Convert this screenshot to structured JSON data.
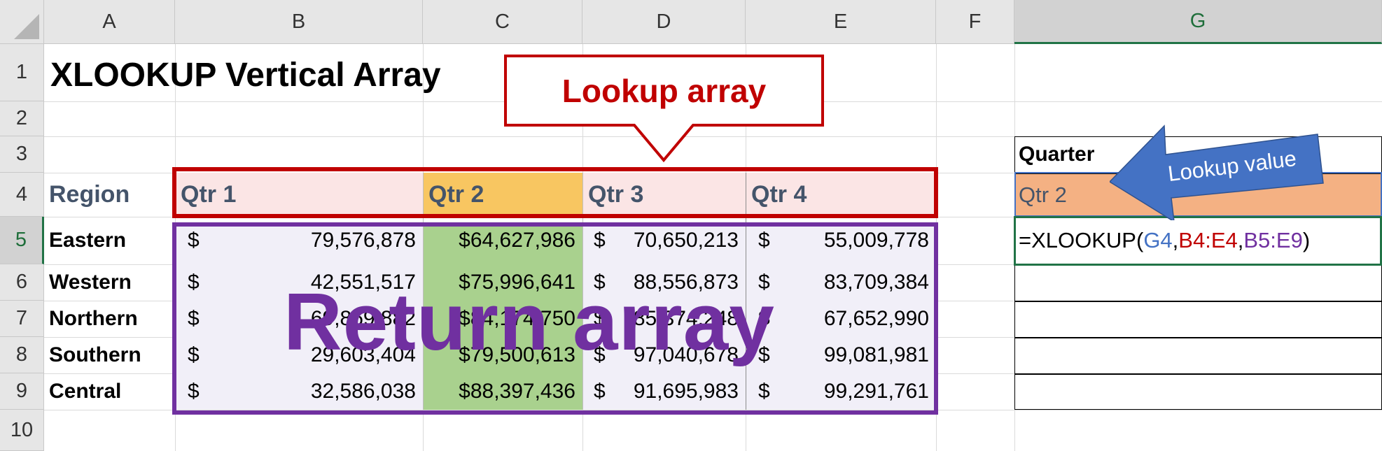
{
  "columns": [
    "A",
    "B",
    "C",
    "D",
    "E",
    "F",
    "G"
  ],
  "rows": [
    "1",
    "2",
    "3",
    "4",
    "5",
    "6",
    "7",
    "8",
    "9",
    "10"
  ],
  "title": "XLOOKUP Vertical Array",
  "header_row": {
    "region": "Region",
    "quarters": [
      "Qtr 1",
      "Qtr 2",
      "Qtr 3",
      "Qtr 4"
    ]
  },
  "table": [
    {
      "region": "Eastern",
      "q1": "79,576,878",
      "q2": "$64,627,986",
      "q3": "70,650,213",
      "q4": "55,009,778"
    },
    {
      "region": "Western",
      "q1": "42,551,517",
      "q2": "$75,996,641",
      "q3": "88,556,873",
      "q4": "83,709,384"
    },
    {
      "region": "Northern",
      "q1": "69,869,882",
      "q2": "$84,174,750",
      "q3": "85,374,248",
      "q4": "67,652,990"
    },
    {
      "region": "Southern",
      "q1": "29,603,404",
      "q2": "$79,500,613",
      "q3": "97,040,678",
      "q4": "99,081,981"
    },
    {
      "region": "Central",
      "q1": "32,586,038",
      "q2": "$88,397,436",
      "q3": "91,695,983",
      "q4": "99,291,761"
    }
  ],
  "currency_symbol": "$",
  "lookup": {
    "label": "Quarter",
    "value": "Qtr 2",
    "formula_parts": [
      "=XLOOKUP(",
      "G4",
      ",",
      "B4:E4",
      ",",
      "B5:E9",
      ")"
    ]
  },
  "callouts": {
    "lookup_array": "Lookup array",
    "lookup_value": "Lookup value",
    "return_array": "Return array"
  },
  "colors": {
    "lookup_array_red": "#c00000",
    "return_array_purple": "#7030a0",
    "lookup_value_blue": "#4472c4",
    "qtr2_header_fill": "#f8c661",
    "return_col_fill": "#a9d18e",
    "lookup_value_fill": "#f4b183",
    "header_row_fill": "#fbe5e5",
    "return_fill": "#f1eff8",
    "selection_green": "#217346"
  }
}
